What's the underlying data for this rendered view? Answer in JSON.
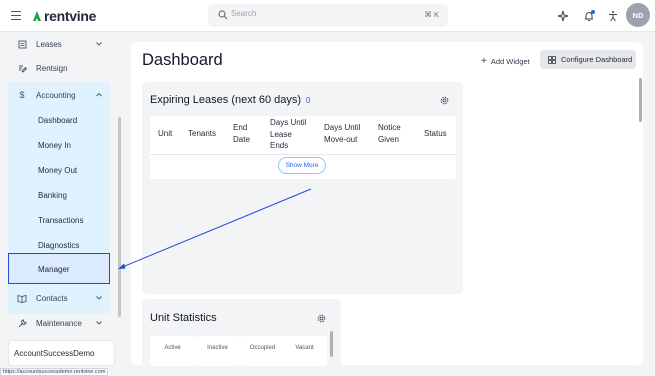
{
  "app": {
    "brand": "rentvine"
  },
  "header": {
    "search_placeholder": "Search",
    "search_shortcut": "⌘ K",
    "icons": [
      "menu-icon",
      "sparkle-icon",
      "bell-icon",
      "accessibility-icon"
    ],
    "avatar_initials": "ND"
  },
  "sidebar": {
    "items": [
      {
        "label": "Leases",
        "icon": "leases-icon"
      },
      {
        "label": "Rentsign",
        "icon": "rentsign-icon"
      },
      {
        "label": "Accounting",
        "icon": "dollar-icon"
      },
      {
        "label": "Contacts",
        "icon": "contacts-icon"
      },
      {
        "label": "Maintenance",
        "icon": "wrench-icon"
      }
    ],
    "accounting_sub": [
      "Dashboard",
      "Money In",
      "Money Out",
      "Banking",
      "Transactions",
      "Diagnostics",
      "Manager"
    ],
    "account_name": "AccountSuccessDemo"
  },
  "main": {
    "title": "Dashboard",
    "add_widget": "Add Widget",
    "configure": "Configure Dashboard",
    "expiring": {
      "title": "Expiring Leases (next 60 days)",
      "count": "0",
      "columns": [
        [
          "Unit"
        ],
        [
          "Tenants"
        ],
        [
          "End",
          "Date"
        ],
        [
          "Days Until",
          "Lease",
          "Ends"
        ],
        [
          "Days Until",
          "Move-out"
        ],
        [
          "Notice",
          "Given"
        ],
        [
          "Status"
        ]
      ],
      "show_more": "Show More"
    },
    "unit_stats": {
      "title": "Unit Statistics",
      "labels": [
        "Active",
        "Inactive",
        "Occupied",
        "Vacant"
      ]
    }
  },
  "statusbar": {
    "url": "https://accountsuccessdemo.rentvine.com"
  },
  "colors": {
    "accent": "#2563eb",
    "sidebar_active": "#e0f2fe",
    "highlight": "#1d4ed8"
  }
}
